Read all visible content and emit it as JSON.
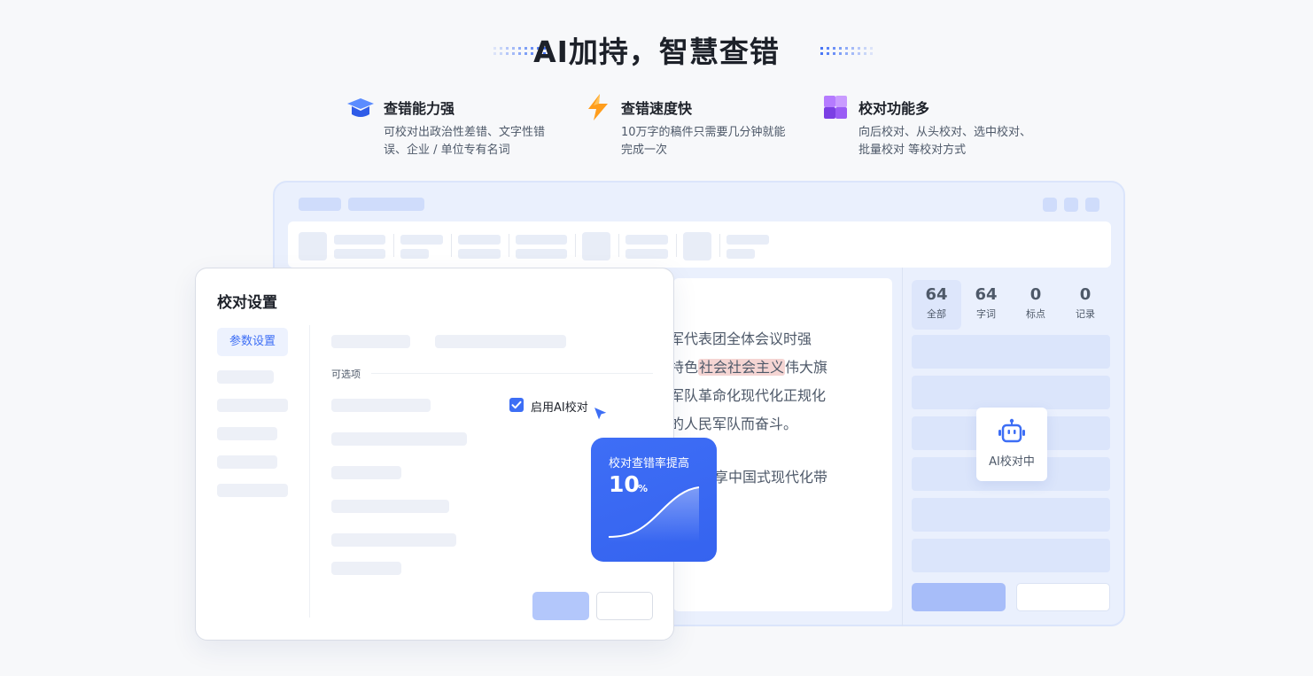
{
  "heading": "AI加持，智慧查错",
  "features": [
    {
      "icon": "graduation-cap-icon",
      "title": "查错能力强",
      "desc": "可校对出政治性差错、文字性错误、企业 / 单位专有名词"
    },
    {
      "icon": "lightning-icon",
      "title": "查错速度快",
      "desc": "10万字的稿件只需要几分钟就能完成一次"
    },
    {
      "icon": "grid-cube-icon",
      "title": "校对功能多",
      "desc": "向后校对、从头校对、选中校对、批量校对 等校对方式"
    }
  ],
  "document": {
    "lines": [
      {
        "before": "军代表团全体会议时强",
        "highlight": "",
        "after": ""
      },
      {
        "before": "特色",
        "highlight": "社会社会主义",
        "after": "伟大旗"
      },
      {
        "before": "军队革命化现代化正规化",
        "highlight": "",
        "after": ""
      },
      {
        "before": "的人民军队而奋斗。",
        "highlight": "",
        "after": ""
      },
      {
        "before": "享中国式现代化带",
        "highlight": "",
        "after": ""
      }
    ]
  },
  "stats": [
    {
      "value": "64",
      "label": "全部",
      "active": true
    },
    {
      "value": "64",
      "label": "字词",
      "active": false
    },
    {
      "value": "0",
      "label": "标点",
      "active": false
    },
    {
      "value": "0",
      "label": "记录",
      "active": false
    }
  ],
  "ai_status": "AI校对中",
  "dialog": {
    "title": "校对设置",
    "nav_active": "参数设置",
    "section_label": "可选项",
    "checkbox_label": "启用AI校对",
    "checkbox_checked": true
  },
  "promo_card": {
    "title": "校对查错率提高",
    "value": "10",
    "unit": "%"
  },
  "colors": {
    "accent": "#3d6ef5",
    "highlight": "#f5d5d3",
    "app_bg": "#eaf0fd"
  }
}
